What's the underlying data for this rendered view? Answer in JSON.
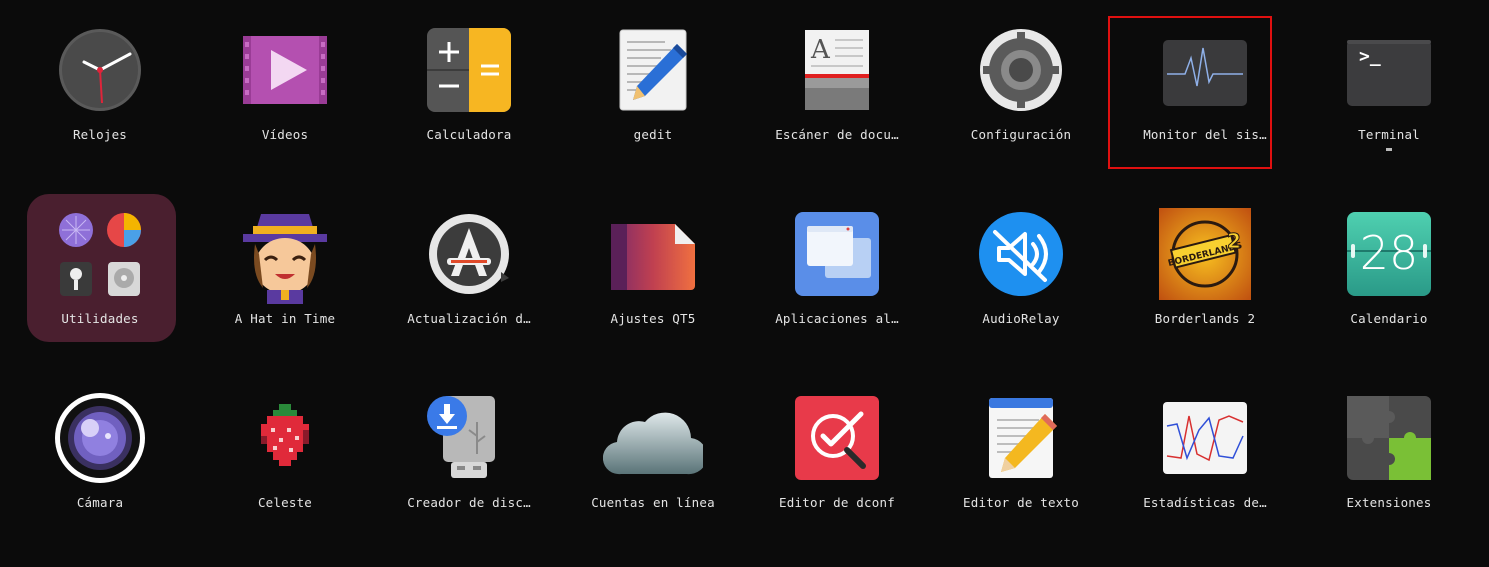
{
  "apps": {
    "row1": [
      {
        "label": "Relojes",
        "icon": "clock-icon"
      },
      {
        "label": "Vídeos",
        "icon": "video-icon"
      },
      {
        "label": "Calculadora",
        "icon": "calculator-icon"
      },
      {
        "label": "gedit",
        "icon": "gedit-icon"
      },
      {
        "label": "Escáner de docu…",
        "icon": "document-scanner-icon"
      },
      {
        "label": "Configuración",
        "icon": "settings-gear-icon"
      },
      {
        "label": "Monitor del sis…",
        "icon": "system-monitor-icon"
      },
      {
        "label": "Terminal",
        "icon": "terminal-icon"
      }
    ],
    "row2": [
      {
        "label": "Utilidades",
        "icon": "utilities-folder-icon"
      },
      {
        "label": "A Hat in Time",
        "icon": "hat-kid-icon"
      },
      {
        "label": "Actualización d…",
        "icon": "software-update-icon"
      },
      {
        "label": "Ajustes QT5",
        "icon": "qt5-settings-icon"
      },
      {
        "label": "Aplicaciones al…",
        "icon": "startup-apps-icon"
      },
      {
        "label": "AudioRelay",
        "icon": "audiorelay-icon"
      },
      {
        "label": "Borderlands 2",
        "icon": "borderlands-icon"
      },
      {
        "label": "Calendario",
        "icon": "calendar-icon"
      }
    ],
    "row3": [
      {
        "label": "Cámara",
        "icon": "camera-icon"
      },
      {
        "label": "Celeste",
        "icon": "strawberry-icon"
      },
      {
        "label": "Creador de disc…",
        "icon": "usb-creator-icon"
      },
      {
        "label": "Cuentas en línea",
        "icon": "cloud-icon"
      },
      {
        "label": "Editor de dconf",
        "icon": "dconf-editor-icon"
      },
      {
        "label": "Editor de texto",
        "icon": "text-editor-icon"
      },
      {
        "label": "Estadísticas de…",
        "icon": "statistics-icon"
      },
      {
        "label": "Extensiones",
        "icon": "puzzle-icon"
      }
    ]
  },
  "calendar_day": "28",
  "terminal_prompt": ">_",
  "colors": {
    "background": "#0b0b0b",
    "folder": "#4a1f2f",
    "highlight": "#e01010"
  }
}
